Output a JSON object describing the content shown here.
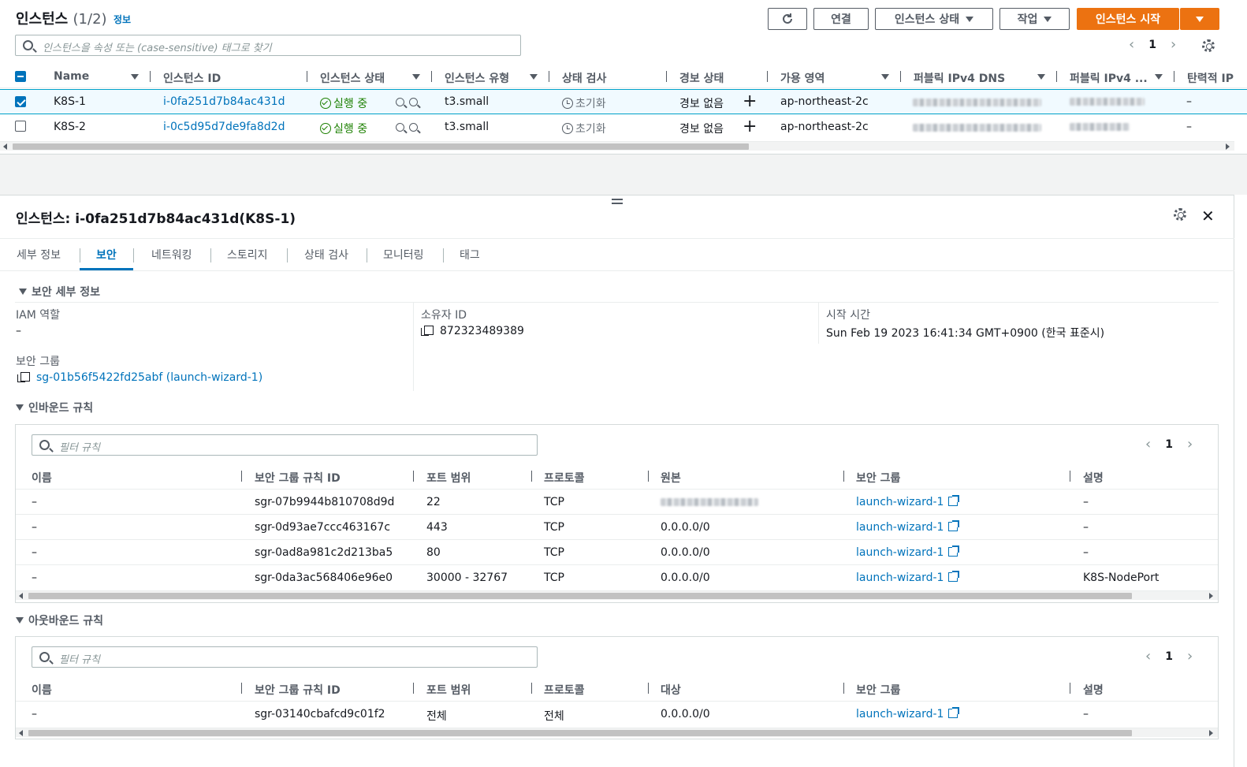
{
  "instances": {
    "title": "인스턴스",
    "count": "(1/2)",
    "info_link": "정보",
    "buttons": {
      "connect": "연결",
      "instance_state": "인스턴스 상태",
      "actions": "작업",
      "launch": "인스턴스 시작"
    },
    "search_placeholder": "인스턴스을 속성 또는 (case-sensitive) 태그로 찾기",
    "page": "1",
    "columns": [
      "Name",
      "인스턴스 ID",
      "인스턴스 상태",
      "인스턴스 유형",
      "상태 검사",
      "경보 상태",
      "가용 영역",
      "퍼블릭 IPv4 DNS",
      "퍼블릭 IPv4 ...",
      "탄력적 IP"
    ],
    "rows": [
      {
        "name": "K8S-1",
        "id": "i-0fa251d7b84ac431d",
        "state": "실행 중",
        "type": "t3.small",
        "check": "초기화",
        "alarm": "경보 없음",
        "az": "ap-northeast-2c",
        "eip": "–"
      },
      {
        "name": "K8S-2",
        "id": "i-0c5d95d7de9fa8d2d",
        "state": "실행 중",
        "type": "t3.small",
        "check": "초기화",
        "alarm": "경보 없음",
        "az": "ap-northeast-2c",
        "eip": "–"
      }
    ]
  },
  "detail": {
    "title": "인스턴스: i-0fa251d7b84ac431d(K8S-1)",
    "tabs": [
      "세부 정보",
      "보안",
      "네트워킹",
      "스토리지",
      "상태 검사",
      "모니터링",
      "태그"
    ],
    "security_details": {
      "heading": "보안 세부 정보",
      "iam_label": "IAM 역할",
      "iam_value": "–",
      "owner_label": "소유자 ID",
      "owner_value": "872323489389",
      "launch_label": "시작 시간",
      "launch_value": "Sun Feb 19 2023 16:41:34 GMT+0900 (한국 표준시)",
      "sg_label": "보안 그룹",
      "sg_value": "sg-01b56f5422fd25abf (launch-wizard-1)"
    },
    "inbound": {
      "heading": "인바운드 규칙",
      "filter_placeholder": "필터 규칙",
      "page": "1",
      "columns": [
        "이름",
        "보안 그룹 규칙 ID",
        "포트 범위",
        "프로토콜",
        "원본",
        "보안 그룹",
        "설명"
      ],
      "rows": [
        {
          "name": "–",
          "rule_id": "sgr-07b9944b810708d9d",
          "port": "22",
          "protocol": "TCP",
          "source": "",
          "sg": "launch-wizard-1",
          "desc": "–"
        },
        {
          "name": "–",
          "rule_id": "sgr-0d93ae7ccc463167c",
          "port": "443",
          "protocol": "TCP",
          "source": "0.0.0.0/0",
          "sg": "launch-wizard-1",
          "desc": "–"
        },
        {
          "name": "–",
          "rule_id": "sgr-0ad8a981c2d213ba5",
          "port": "80",
          "protocol": "TCP",
          "source": "0.0.0.0/0",
          "sg": "launch-wizard-1",
          "desc": "–"
        },
        {
          "name": "–",
          "rule_id": "sgr-0da3ac568406e96e0",
          "port": "30000 - 32767",
          "protocol": "TCP",
          "source": "0.0.0.0/0",
          "sg": "launch-wizard-1",
          "desc": "K8S-NodePort"
        }
      ]
    },
    "outbound": {
      "heading": "아웃바운드 규칙",
      "filter_placeholder": "필터 규칙",
      "page": "1",
      "columns": [
        "이름",
        "보안 그룹 규칙 ID",
        "포트 범위",
        "프로토콜",
        "대상",
        "보안 그룹",
        "설명"
      ],
      "rows": [
        {
          "name": "–",
          "rule_id": "sgr-03140cbafcd9c01f2",
          "port": "전체",
          "protocol": "전체",
          "dest": "0.0.0.0/0",
          "sg": "launch-wizard-1",
          "desc": "–"
        }
      ]
    }
  },
  "colors": {
    "accent": "#0073bb",
    "launch_orange": "#ec7211",
    "running_green": "#1d8102"
  },
  "icons": [
    "refresh-icon",
    "search-icon",
    "settings-gear-icon",
    "check-circle-icon",
    "clock-icon",
    "zoom-in-icon",
    "zoom-out-icon",
    "plus-icon",
    "copy-icon",
    "external-link-icon",
    "close-icon"
  ]
}
